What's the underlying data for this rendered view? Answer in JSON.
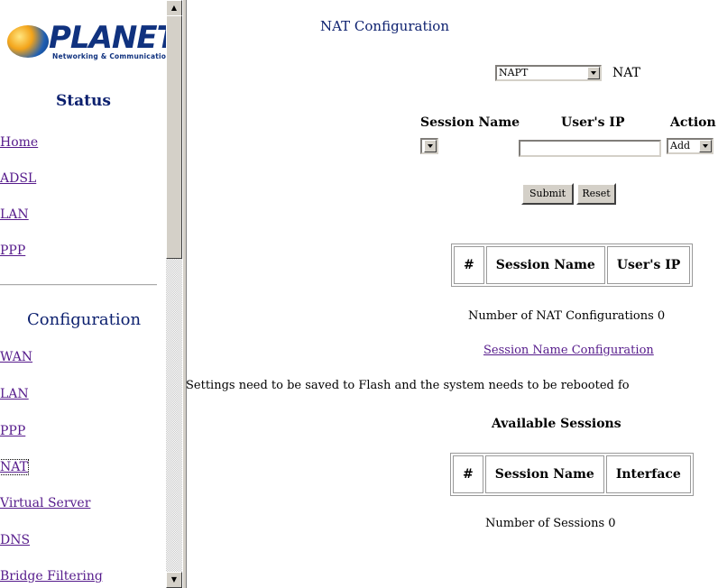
{
  "brand": {
    "name": "PLANET",
    "tagline": "Networking & Communication"
  },
  "sidebar": {
    "status_title": "Status",
    "status_links": [
      "Home",
      "ADSL",
      "LAN",
      "PPP"
    ],
    "config_title": "Configuration",
    "config_links": [
      "WAN",
      "LAN",
      "PPP",
      "NAT",
      "Virtual Server",
      "DNS",
      "Bridge Filtering"
    ],
    "active_link": "NAT"
  },
  "main": {
    "title": "NAT Configuration",
    "mode_select": "NAPT",
    "mode_label": "NAT",
    "form_headers": {
      "session_name": "Session Name",
      "users_ip": "User's IP",
      "action": "Action"
    },
    "session_select": "",
    "users_ip_value": "",
    "action_select": "Add",
    "submit_label": "Submit",
    "reset_label": "Reset",
    "nat_table_headers": [
      "#",
      "Session Name",
      "User's IP"
    ],
    "nat_count_text": "Number of NAT Configurations 0",
    "session_link": "Session Name Configuration",
    "notice": "Settings need to be saved to Flash and the system needs to be rebooted fo",
    "available_title": "Available Sessions",
    "sessions_table_headers": [
      "#",
      "Session Name",
      "Interface"
    ],
    "sessions_count_text": "Number of Sessions 0"
  },
  "colors": {
    "link": "#551a8b",
    "heading": "#0b1f6e",
    "brand": "#10327f"
  }
}
